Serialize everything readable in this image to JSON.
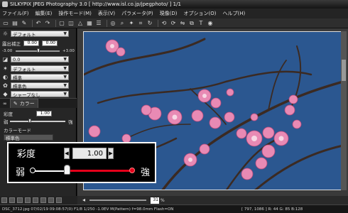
{
  "window": {
    "title": "SILKYPIX JPEG Photography 3.0 [ http://www.isl.co.jp/jpegphoto/ ]  1/1"
  },
  "menu": [
    "ファイル(F)",
    "編集(E)",
    "操作モード(M)",
    "表示(V)",
    "パラメータ(P)",
    "現像(D)",
    "オプション(O)",
    "ヘルプ(H)"
  ],
  "panel": {
    "wb_preset": "デフォルト",
    "exposure_label": "露出補正",
    "exposure_value_a": "0.00",
    "exposure_value_b": "0.00",
    "exposure_min": "-3.00",
    "exposure_max": "+3.00",
    "gamma_preset": "0.0",
    "tone_preset": "デフォルト",
    "contrast_preset": "標準",
    "color_preset": "標準色",
    "sharpness_preset": "シャープなし",
    "tab_color": "カラー",
    "saturation_label": "彩度",
    "saturation_value": "1.00",
    "weak_label": "弱",
    "strong_label": "強",
    "color_mode_label": "カラーモード",
    "color_mode_value": "標準色"
  },
  "popup": {
    "label": "彩度",
    "value": "1.00",
    "weak": "弱",
    "strong": "強",
    "level": 0.35
  },
  "zoom": {
    "value": "31",
    "unit": "%"
  },
  "status": {
    "left": "DSC_3712.jpg  07/02/19 09:08:57(0) F1/8  1/250  -1.0EV  M(Pattern)  f=98.0mm  Flash=ON",
    "right": "[  797, 1086 ]    R: 44  G: 85  B:128"
  },
  "colors": {
    "sky": "#28508a",
    "accent_red": "#e5001a",
    "blossom": "#e88ab4"
  }
}
